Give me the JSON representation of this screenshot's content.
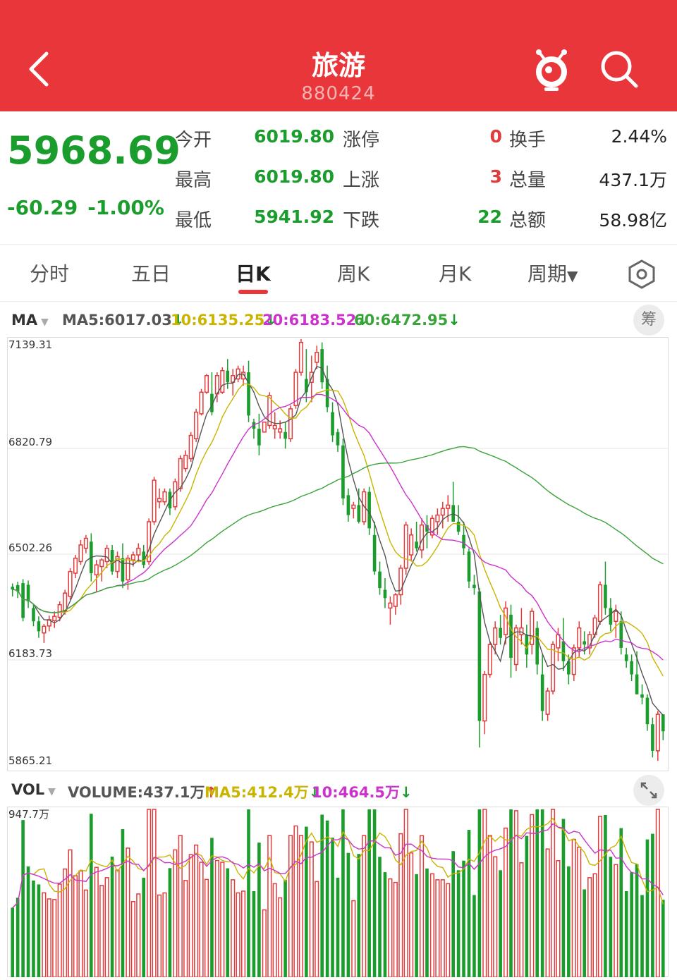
{
  "header": {
    "title": "旅游",
    "code": "880424",
    "bg_color": "#e8363a"
  },
  "quote": {
    "price": "5968.69",
    "change": "-60.29",
    "change_pct": "-1.00%",
    "open_label": "今开",
    "open": "6019.80",
    "high_label": "最高",
    "high": "6019.80",
    "low_label": "最低",
    "low": "5941.92",
    "limit_up_label": "涨停",
    "limit_up": "0",
    "up_label": "上涨",
    "up": "3",
    "down_label": "下跌",
    "down": "22",
    "turnover_label": "换手",
    "turnover": "2.44%",
    "volume_label": "总量",
    "volume": "437.1万",
    "amount_label": "总额",
    "amount": "58.98亿"
  },
  "tabs": [
    "分时",
    "五日",
    "日K",
    "周K",
    "月K",
    "周期"
  ],
  "active_tab": "日K",
  "ma_bar": {
    "button": "MA",
    "ma5": "MA5:6017.03",
    "ma10": "10:6135.25",
    "ma20": "20:6183.52",
    "ma60": "60:6472.95",
    "calc": "筹"
  },
  "vol_bar": {
    "button": "VOL",
    "volume": "VOLUME:437.1万",
    "ma5": "MA5:412.4万",
    "ma10": "10:464.5万"
  },
  "colors": {
    "up": "#e23b3b",
    "down": "#1a9d2c",
    "ma5": "#555555",
    "ma10": "#c9b400",
    "ma20": "#cc33cc",
    "ma60": "#3aa33a"
  },
  "chart_data": [
    {
      "type": "candlestick",
      "y_tick_labels": [
        "7139.31",
        "6820.79",
        "6502.26",
        "6183.73",
        "5865.21"
      ],
      "ylim": [
        5865.21,
        7139.31
      ],
      "candles": [
        [
          6404,
          6414,
          6375,
          6396
        ],
        [
          6409,
          6419,
          6370,
          6390
        ],
        [
          6415,
          6427,
          6300,
          6310
        ],
        [
          6410,
          6423,
          6340,
          6360
        ],
        [
          6340,
          6350,
          6285,
          6300
        ],
        [
          6300,
          6315,
          6250,
          6270
        ],
        [
          6265,
          6292,
          6235,
          6285
        ],
        [
          6286,
          6317,
          6270,
          6305
        ],
        [
          6302,
          6330,
          6280,
          6315
        ],
        [
          6312,
          6360,
          6300,
          6350
        ],
        [
          6330,
          6395,
          6320,
          6385
        ],
        [
          6375,
          6460,
          6365,
          6450
        ],
        [
          6445,
          6500,
          6430,
          6490
        ],
        [
          6480,
          6545,
          6470,
          6530
        ],
        [
          6520,
          6560,
          6505,
          6550
        ],
        [
          6540,
          6565,
          6420,
          6445
        ],
        [
          6440,
          6485,
          6390,
          6470
        ],
        [
          6465,
          6490,
          6420,
          6485
        ],
        [
          6480,
          6530,
          6460,
          6520
        ],
        [
          6515,
          6530,
          6440,
          6450
        ],
        [
          6450,
          6510,
          6430,
          6495
        ],
        [
          6490,
          6535,
          6400,
          6420
        ],
        [
          6425,
          6500,
          6395,
          6490
        ],
        [
          6485,
          6510,
          6465,
          6500
        ],
        [
          6500,
          6535,
          6480,
          6520
        ],
        [
          6510,
          6530,
          6460,
          6470
        ],
        [
          6480,
          6610,
          6470,
          6600
        ],
        [
          6600,
          6735,
          6590,
          6725
        ],
        [
          6660,
          6700,
          6640,
          6670
        ],
        [
          6660,
          6700,
          6650,
          6690
        ],
        [
          6690,
          6700,
          6620,
          6640
        ],
        [
          6645,
          6730,
          6635,
          6720
        ],
        [
          6700,
          6800,
          6690,
          6790
        ],
        [
          6760,
          6815,
          6750,
          6800
        ],
        [
          6790,
          6870,
          6780,
          6860
        ],
        [
          6850,
          6940,
          6840,
          6930
        ],
        [
          6925,
          7000,
          6920,
          6990
        ],
        [
          6990,
          7045,
          6985,
          7040
        ],
        [
          6985,
          7050,
          6920,
          6930
        ],
        [
          6985,
          7050,
          6960,
          7040
        ],
        [
          6990,
          7065,
          6985,
          7055
        ],
        [
          7055,
          7090,
          7000,
          7020
        ],
        [
          7020,
          7060,
          6980,
          7040
        ],
        [
          7030,
          7070,
          7020,
          7060
        ],
        [
          7030,
          7070,
          7010,
          7050
        ],
        [
          7050,
          7085,
          6900,
          6920
        ],
        [
          6900,
          6910,
          6850,
          6880
        ],
        [
          6880,
          6925,
          6800,
          6830
        ],
        [
          6870,
          6900,
          6880,
          6900
        ],
        [
          6890,
          6990,
          6880,
          6980
        ],
        [
          6880,
          6930,
          6850,
          6890
        ],
        [
          6870,
          6905,
          6850,
          6880
        ],
        [
          6870,
          6900,
          6820,
          6850
        ],
        [
          6850,
          6950,
          6840,
          6940
        ],
        [
          6950,
          7060,
          6940,
          7050
        ],
        [
          7050,
          7150,
          7040,
          7140
        ],
        [
          7030,
          7120,
          6960,
          6990
        ],
        [
          7020,
          7100,
          6960,
          7050
        ],
        [
          7080,
          7130,
          7060,
          7110
        ],
        [
          7120,
          7140,
          7000,
          7020
        ],
        [
          7030,
          7070,
          6930,
          6945
        ],
        [
          6930,
          6960,
          6840,
          6860
        ],
        [
          6870,
          6880,
          6810,
          6830
        ],
        [
          6830,
          6850,
          6650,
          6670
        ],
        [
          6680,
          6700,
          6600,
          6620
        ],
        [
          6640,
          6660,
          6610,
          6650
        ],
        [
          6650,
          6700,
          6595,
          6600
        ],
        [
          6600,
          6700,
          6590,
          6690
        ],
        [
          6690,
          6705,
          6560,
          6580
        ],
        [
          6560,
          6600,
          6440,
          6450
        ],
        [
          6450,
          6480,
          6380,
          6400
        ],
        [
          6395,
          6430,
          6340,
          6370
        ],
        [
          6340,
          6375,
          6290,
          6355
        ],
        [
          6345,
          6385,
          6320,
          6380
        ],
        [
          6380,
          6470,
          6350,
          6460
        ],
        [
          6460,
          6600,
          6440,
          6590
        ],
        [
          6500,
          6580,
          6480,
          6560
        ],
        [
          6540,
          6600,
          6510,
          6520
        ],
        [
          6515,
          6610,
          6490,
          6590
        ],
        [
          6590,
          6620,
          6520,
          6570
        ],
        [
          6560,
          6620,
          6550,
          6610
        ],
        [
          6600,
          6640,
          6560,
          6620
        ],
        [
          6620,
          6660,
          6580,
          6640
        ],
        [
          6640,
          6680,
          6600,
          6650
        ],
        [
          6650,
          6720,
          6610,
          6600
        ],
        [
          6600,
          6650,
          6560,
          6570
        ],
        [
          6560,
          6600,
          6500,
          6520
        ],
        [
          6510,
          6520,
          6400,
          6420
        ],
        [
          6410,
          6440,
          6380,
          6400
        ],
        [
          6390,
          6400,
          5920,
          6000
        ],
        [
          6000,
          6150,
          5960,
          6140
        ],
        [
          6140,
          6240,
          6130,
          6230
        ],
        [
          6230,
          6300,
          6200,
          6280
        ],
        [
          6280,
          6320,
          6230,
          6250
        ],
        [
          6260,
          6360,
          6230,
          6340
        ],
        [
          6320,
          6350,
          6130,
          6190
        ],
        [
          6170,
          6290,
          6150,
          6280
        ],
        [
          6260,
          6340,
          6230,
          6280
        ],
        [
          6260,
          6290,
          6160,
          6200
        ],
        [
          6230,
          6340,
          6200,
          6330
        ],
        [
          6280,
          6300,
          6140,
          6170
        ],
        [
          6140,
          6200,
          6000,
          6030
        ],
        [
          6020,
          6100,
          6000,
          6090
        ],
        [
          6090,
          6240,
          6080,
          6230
        ],
        [
          6220,
          6280,
          6180,
          6260
        ],
        [
          6240,
          6310,
          6150,
          6180
        ],
        [
          6180,
          6200,
          6110,
          6140
        ],
        [
          6140,
          6230,
          6120,
          6220
        ],
        [
          6220,
          6300,
          6190,
          6280
        ],
        [
          6240,
          6270,
          6200,
          6230
        ],
        [
          6220,
          6270,
          6200,
          6260
        ],
        [
          6260,
          6320,
          6250,
          6310
        ],
        [
          6300,
          6420,
          6290,
          6410
        ],
        [
          6410,
          6480,
          6320,
          6340
        ],
        [
          6340,
          6370,
          6270,
          6290
        ],
        [
          6300,
          6350,
          6250,
          6330
        ],
        [
          6300,
          6330,
          6200,
          6220
        ],
        [
          6200,
          6220,
          6160,
          6180
        ],
        [
          6180,
          6200,
          6120,
          6140
        ],
        [
          6140,
          6210,
          6130,
          6080
        ],
        [
          6080,
          6110,
          6050,
          6070
        ],
        [
          6070,
          6080,
          5970,
          5990
        ],
        [
          5990,
          6010,
          5890,
          5910
        ],
        [
          5910,
          6030,
          5880,
          6020
        ],
        [
          6019.8,
          6019.8,
          5941.92,
          5968.69
        ]
      ],
      "ma5_last": 6017.03,
      "ma10_last": 6135.25,
      "ma20_last": 6183.52,
      "ma60_last": 6472.95
    },
    {
      "type": "bar",
      "y_tick_labels": [
        "947.7万"
      ],
      "ylim": [
        0,
        947.7
      ],
      "volume_last": 437.1,
      "ma5_last": 412.4,
      "ma10_last": 464.5
    }
  ]
}
